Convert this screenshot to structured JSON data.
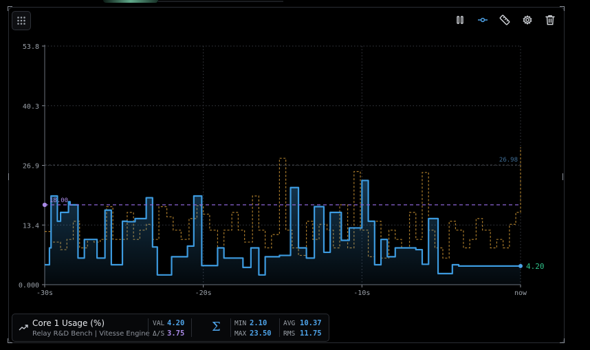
{
  "toolbar": {
    "grid_icon": "grid-icon",
    "pause_icon": "pause-icon",
    "points_icon": "line-points-icon",
    "ruler_icon": "ruler-icon",
    "settings_icon": "gear-icon",
    "delete_icon": "trash-icon",
    "active_color": "#4ea3e8"
  },
  "legend": {
    "title": "Core 1 Usage (%)",
    "subtitle": "Relay R&D Bench | Vitesse Engine",
    "trend_icon": "trend-up-icon",
    "sigma_icon": "sigma-icon",
    "val_label": "VAL",
    "val": "4.20",
    "rate_label": "Δ/S",
    "rate": "3.75",
    "min_label": "MIN",
    "min": "2.10",
    "max_label": "MAX",
    "max": "23.50",
    "avg_label": "AVG",
    "avg": "10.37",
    "rms_label": "RMS",
    "rms": "11.75"
  },
  "chart_data": {
    "type": "line",
    "x_range": [
      -30,
      0
    ],
    "ylim": [
      0,
      53.8
    ],
    "y_ticks": [
      "0.000",
      "13.4",
      "26.9",
      "40.3",
      "53.8"
    ],
    "x_ticks": [
      "-30s",
      "-20s",
      "-10s",
      "now"
    ],
    "grid": true,
    "colors": {
      "primary": "#3d9be0",
      "secondary": "#a87a2a",
      "threshold": "#8a64d6",
      "current": "#2fc28a",
      "max_line": "#4a4e55"
    },
    "threshold": {
      "value": 18.0,
      "label": "18.00"
    },
    "max_marker": {
      "value": 26.98,
      "label": "26.98"
    },
    "current": {
      "value": 4.2,
      "label": "4.20"
    },
    "series": [
      {
        "style": "solid",
        "x": [
          -30,
          -29.7,
          -29.6,
          -29.2,
          -29.0,
          -28.5,
          -28.4,
          -27.9,
          -27.5,
          -27.1,
          -26.7,
          -26.2,
          -25.8,
          -25.1,
          -24.8,
          -24.3,
          -23.6,
          -23.2,
          -22.9,
          -22.4,
          -22.0,
          -21.3,
          -21.0,
          -20.6,
          -20.1,
          -19.1,
          -18.7,
          -17.5,
          -17.0,
          -16.5,
          -16.1,
          -15.7,
          -15.2,
          -14.5,
          -14.0,
          -13.5,
          -13.0,
          -12.4,
          -12.0,
          -11.3,
          -10.8,
          -10.4,
          -10.0,
          -9.6,
          -9.2,
          -8.8,
          -8.4,
          -7.9,
          -7.4,
          -6.6,
          -6.2,
          -5.8,
          -5.2,
          -4.8,
          -4.3,
          -3.9,
          -3.4,
          -3.0,
          -2.4,
          -1.8,
          -1.3,
          -0.9,
          -0.4,
          0
        ],
        "y": [
          4.5,
          8.3,
          20.0,
          14.3,
          16.3,
          18.7,
          18.0,
          6.0,
          10.2,
          10.2,
          6.0,
          16.8,
          4.5,
          14.3,
          14.2,
          14.9,
          19.6,
          8.5,
          2.2,
          2.2,
          6.3,
          6.3,
          8.7,
          20.0,
          4.3,
          8.3,
          6.0,
          3.9,
          8.3,
          2.2,
          6.3,
          6.3,
          6.6,
          21.9,
          8.3,
          6.0,
          17.6,
          7.3,
          16.3,
          10.0,
          12.8,
          12.8,
          23.5,
          14.3,
          4.5,
          10.2,
          6.3,
          8.3,
          8.3,
          7.9,
          4.6,
          14.9,
          2.5,
          2.5,
          4.5,
          4.2,
          4.2,
          4.2,
          4.2,
          4.2,
          4.2,
          4.2,
          4.2,
          4.2
        ]
      },
      {
        "style": "dashed",
        "x": [
          -30,
          -29.6,
          -29.0,
          -28.6,
          -28.2,
          -27.8,
          -27.3,
          -26.9,
          -26.5,
          -26.1,
          -25.7,
          -25.3,
          -24.8,
          -24.4,
          -24.0,
          -23.6,
          -23.2,
          -22.8,
          -22.3,
          -21.9,
          -21.4,
          -20.9,
          -20.4,
          -20.0,
          -19.6,
          -19.1,
          -18.7,
          -18.2,
          -17.8,
          -17.4,
          -16.9,
          -16.5,
          -16.1,
          -15.7,
          -15.2,
          -14.8,
          -14.4,
          -14.0,
          -13.5,
          -13.1,
          -12.7,
          -12.2,
          -11.8,
          -11.4,
          -10.9,
          -10.5,
          -10.1,
          -9.6,
          -9.2,
          -8.8,
          -8.3,
          -7.9,
          -7.5,
          -7.0,
          -6.6,
          -6.2,
          -5.8,
          -5.4,
          -4.9,
          -4.5,
          -4.1,
          -3.6,
          -3.2,
          -2.8,
          -2.4,
          -1.9,
          -1.5,
          -1.1,
          -0.7,
          -0.3,
          0
        ],
        "y": [
          12.0,
          9.6,
          7.9,
          10.2,
          14.3,
          8.3,
          10.2,
          9.6,
          10.2,
          17.6,
          10.2,
          10.2,
          16.3,
          10.2,
          12.3,
          13.6,
          10.2,
          17.6,
          15.3,
          12.3,
          10.2,
          14.9,
          17.8,
          15.9,
          12.3,
          8.3,
          12.3,
          16.3,
          12.3,
          9.6,
          20.0,
          12.3,
          8.3,
          11.3,
          28.5,
          12.3,
          8.3,
          6.6,
          14.3,
          10.2,
          13.6,
          12.3,
          8.3,
          18.0,
          8.3,
          25.5,
          12.3,
          6.3,
          14.3,
          6.0,
          12.3,
          10.2,
          8.3,
          16.3,
          10.2,
          25.3,
          12.3,
          8.3,
          6.0,
          14.3,
          12.3,
          8.3,
          10.2,
          14.9,
          12.3,
          8.3,
          10.2,
          8.3,
          13.6,
          16.3,
          31.0
        ]
      }
    ]
  }
}
